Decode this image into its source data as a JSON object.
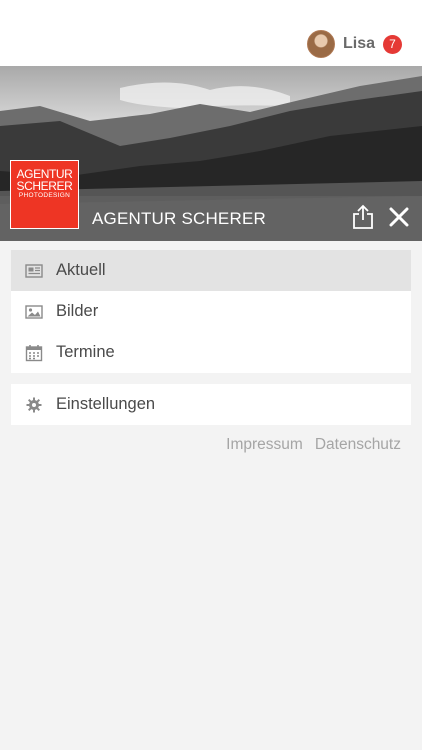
{
  "header": {
    "user_name": "Lisa",
    "notification_count": "7"
  },
  "brand": {
    "name": "AGENTUR SCHERER",
    "logo_line1": "AGENTUR",
    "logo_line2": "SCHERER",
    "logo_line3": "PHOTODESIGN"
  },
  "menu": {
    "items": [
      {
        "label": "Aktuell",
        "icon": "newspaper-icon",
        "active": true
      },
      {
        "label": "Bilder",
        "icon": "image-icon"
      },
      {
        "label": "Termine",
        "icon": "calendar-icon"
      }
    ],
    "settings_label": "Einstellungen"
  },
  "footer": {
    "impressum": "Impressum",
    "datenschutz": "Datenschutz"
  },
  "colors": {
    "badge": "#e53935",
    "logo": "#ee3524"
  }
}
